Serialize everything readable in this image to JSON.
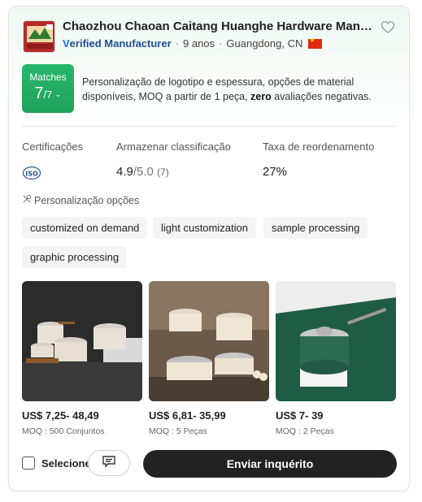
{
  "supplier": {
    "name": "Chaozhou Chaoan Caitang Huanghe Hardware Manufa...",
    "verified_prefix": "V",
    "verified_label": "erified Manufacturer",
    "years": "9 anos",
    "location": "Guangdong, CN",
    "country_flag": "flag-cn-icon"
  },
  "matches": {
    "label": "Matches",
    "score": "7",
    "total": "/7"
  },
  "summary": {
    "text_before": "Personalização de logotipo e espessura, opções de material disponíveis, MOQ a partir de 1 peça, ",
    "bold": "zero",
    "text_after": " avaliações negativas."
  },
  "stats": {
    "cert_label": "Certificações",
    "cert_icon": "iso-icon",
    "rating_label": "Armazenar classificação",
    "rating_value": "4.9",
    "rating_max": "/5.0",
    "rating_count": "(7)",
    "reorder_label": "Taxa de reordenamento",
    "reorder_value": "27%"
  },
  "customization": {
    "title": "Personalização opções",
    "tags": [
      "customized on demand",
      "light customization",
      "sample processing",
      "graphic processing"
    ]
  },
  "products": [
    {
      "price": "US$ 7,25- 48,49",
      "moq": "MOQ : 500 Conjuntos"
    },
    {
      "price": "US$ 6,81- 35,99",
      "moq": "MOQ : 5 Peças"
    },
    {
      "price": "US$ 7- 39",
      "moq": "MOQ : 2 Peças"
    }
  ],
  "actions": {
    "select_label": "Selecione",
    "inquiry_label": "Enviar inquérito"
  },
  "colors": {
    "match_green": "#22b065",
    "verified_blue": "#1d4f91",
    "button_dark": "#222222"
  }
}
